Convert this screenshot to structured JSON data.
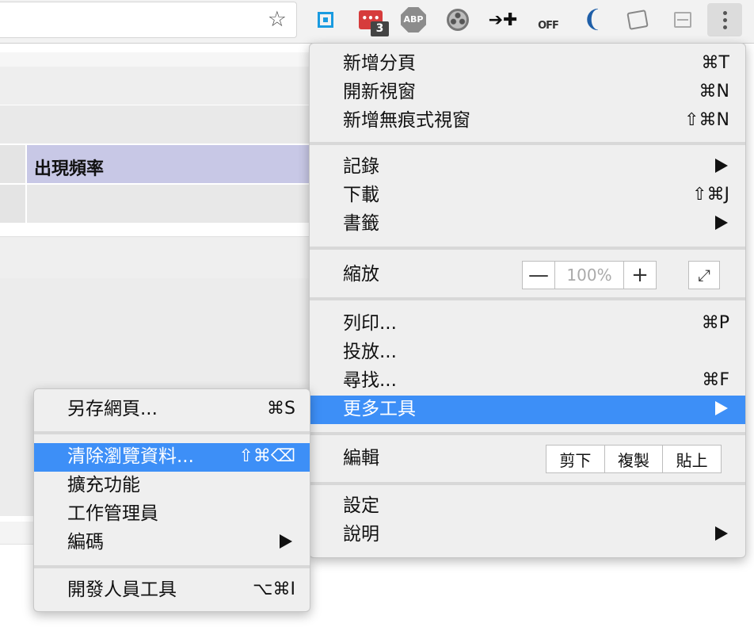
{
  "toolbar": {
    "extensions": [
      {
        "name": "square-extension-icon"
      },
      {
        "name": "red-counter-extension-icon",
        "badge": "3"
      },
      {
        "name": "adblock-plus-icon",
        "text": "ABP"
      },
      {
        "name": "film-reel-icon"
      },
      {
        "name": "arrows-extension-icon"
      },
      {
        "name": "off-extension-icon",
        "text": "OFF"
      },
      {
        "name": "jquery-icon"
      },
      {
        "name": "notepad-icon"
      },
      {
        "name": "printer-icon"
      }
    ]
  },
  "page": {
    "table_header": "出現頻率"
  },
  "main_menu": {
    "new_tab": {
      "label": "新增分頁",
      "shortcut": "⌘T"
    },
    "new_window": {
      "label": "開新視窗",
      "shortcut": "⌘N"
    },
    "new_incognito": {
      "label": "新增無痕式視窗",
      "shortcut": "⇧⌘N"
    },
    "history": {
      "label": "記錄"
    },
    "downloads": {
      "label": "下載",
      "shortcut": "⇧⌘J"
    },
    "bookmarks": {
      "label": "書籤"
    },
    "zoom": {
      "label": "縮放",
      "minus": "—",
      "level": "100%",
      "plus": "+"
    },
    "print": {
      "label": "列印...",
      "shortcut": "⌘P"
    },
    "cast": {
      "label": "投放..."
    },
    "find": {
      "label": "尋找...",
      "shortcut": "⌘F"
    },
    "more_tools": {
      "label": "更多工具"
    },
    "edit": {
      "label": "編輯",
      "cut": "剪下",
      "copy": "複製",
      "paste": "貼上"
    },
    "settings": {
      "label": "設定"
    },
    "help": {
      "label": "說明"
    }
  },
  "more_tools_menu": {
    "save_page": {
      "label": "另存網頁...",
      "shortcut": "⌘S"
    },
    "clear_data": {
      "label": "清除瀏覽資料...",
      "shortcut": "⇧⌘⌫"
    },
    "extensions": {
      "label": "擴充功能"
    },
    "task_manager": {
      "label": "工作管理員"
    },
    "encoding": {
      "label": "編碼"
    },
    "dev_tools": {
      "label": "開發人員工具",
      "shortcut": "⌥⌘I"
    }
  },
  "colors": {
    "highlight": "#3d8ff7",
    "table_header_bg": "#c8c8e6",
    "menu_bg": "#efefef"
  }
}
